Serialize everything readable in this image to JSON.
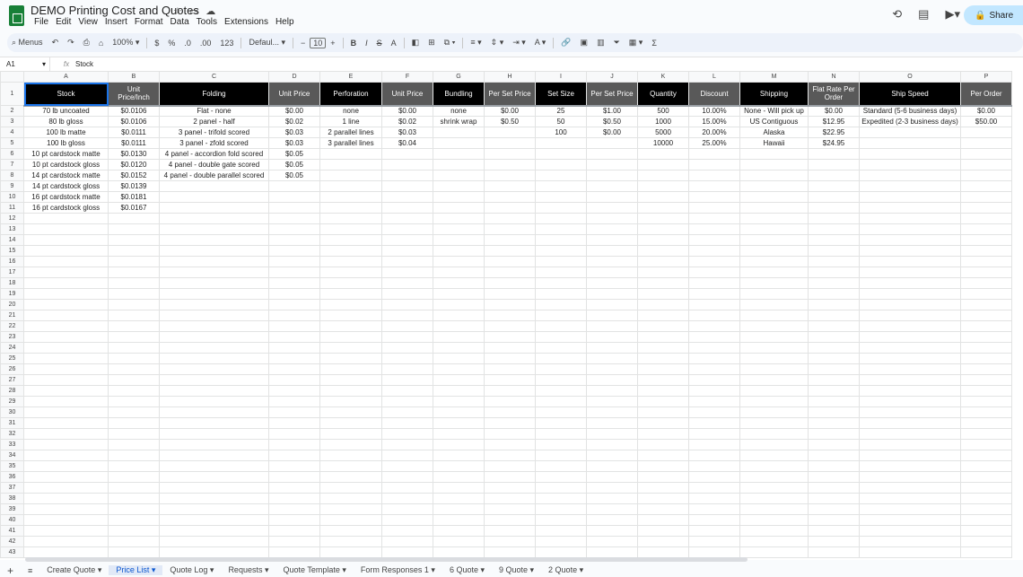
{
  "app": {
    "title": "DEMO Printing Cost and Quotes"
  },
  "menu": [
    "File",
    "Edit",
    "View",
    "Insert",
    "Format",
    "Data",
    "Tools",
    "Extensions",
    "Help"
  ],
  "share_label": "Share",
  "toolbar": {
    "menus": "Menus",
    "zoom": "100%",
    "currency": "$",
    "percent": "%",
    "dec_dec": ".0",
    "inc_dec": ".00",
    "number_fmt": "123",
    "font": "Defaul...",
    "font_size": "10",
    "bold": "B",
    "italic": "I",
    "strike": "S",
    "textcolor": "A"
  },
  "formula": {
    "cell": "A1",
    "value": "Stock"
  },
  "columns": [
    "A",
    "B",
    "C",
    "D",
    "E",
    "F",
    "G",
    "H",
    "I",
    "J",
    "K",
    "L",
    "M",
    "N",
    "O",
    "P"
  ],
  "headers": [
    "Stock",
    "Unit Price/Inch",
    "Folding",
    "Unit Price",
    "Perforation",
    "Unit Price",
    "Bundling",
    "Per Set Price",
    "Set Size",
    "Per Set Price",
    "Quantity",
    "Discount",
    "Shipping",
    "Flat Rate Per Order",
    "Ship Speed",
    "Per Order"
  ],
  "rows": [
    [
      "70 lb uncoated",
      "$0.0106",
      "Flat - none",
      "$0.00",
      "none",
      "$0.00",
      "none",
      "$0.00",
      "25",
      "$1.00",
      "500",
      "10.00%",
      "None - Will pick up",
      "$0.00",
      "Standard (5-6 business days)",
      "$0.00"
    ],
    [
      "80 lb gloss",
      "$0.0106",
      "2 panel - half",
      "$0.02",
      "1 line",
      "$0.02",
      "shrink wrap",
      "$0.50",
      "50",
      "$0.50",
      "1000",
      "15.00%",
      "US Contiguous",
      "$12.95",
      "Expedited (2-3 business days)",
      "$50.00"
    ],
    [
      "100 lb matte",
      "$0.0111",
      "3 panel - trifold scored",
      "$0.03",
      "2 parallel lines",
      "$0.03",
      "",
      "",
      "100",
      "$0.00",
      "5000",
      "20.00%",
      "Alaska",
      "$22.95",
      "",
      ""
    ],
    [
      "100 lb gloss",
      "$0.0111",
      "3 panel - zfold scored",
      "$0.03",
      "3 parallel lines",
      "$0.04",
      "",
      "",
      "",
      "",
      "10000",
      "25.00%",
      "Hawaii",
      "$24.95",
      "",
      ""
    ],
    [
      "10 pt cardstock matte",
      "$0.0130",
      "4 panel - accordion fold scored",
      "$0.05",
      "",
      "",
      "",
      "",
      "",
      "",
      "",
      "",
      "",
      "",
      "",
      ""
    ],
    [
      "10 pt cardstock gloss",
      "$0.0120",
      "4 panel - double gate scored",
      "$0.05",
      "",
      "",
      "",
      "",
      "",
      "",
      "",
      "",
      "",
      "",
      "",
      ""
    ],
    [
      "14 pt cardstock matte",
      "$0.0152",
      "4 panel - double parallel scored",
      "$0.05",
      "",
      "",
      "",
      "",
      "",
      "",
      "",
      "",
      "",
      "",
      "",
      ""
    ],
    [
      "14 pt cardstock gloss",
      "$0.0139",
      "",
      "",
      "",
      "",
      "",
      "",
      "",
      "",
      "",
      "",
      "",
      "",
      "",
      ""
    ],
    [
      "16 pt cardstock matte",
      "$0.0181",
      "",
      "",
      "",
      "",
      "",
      "",
      "",
      "",
      "",
      "",
      "",
      "",
      "",
      ""
    ],
    [
      "16 pt cardstock gloss",
      "$0.0167",
      "",
      "",
      "",
      "",
      "",
      "",
      "",
      "",
      "",
      "",
      "",
      "",
      "",
      ""
    ]
  ],
  "row_numbers": [
    "1",
    "2",
    "3",
    "4",
    "5",
    "6",
    "7",
    "8",
    "9",
    "10",
    "11",
    "12",
    "13",
    "14",
    "15",
    "16",
    "17",
    "18",
    "19",
    "20",
    "21",
    "22",
    "23",
    "24",
    "25",
    "26",
    "27",
    "28",
    "29",
    "30",
    "31",
    "32",
    "33",
    "34",
    "35",
    "36",
    "37",
    "38",
    "39",
    "40",
    "41",
    "42",
    "43"
  ],
  "sheets": [
    {
      "label": "Create Quote",
      "active": false
    },
    {
      "label": "Price List",
      "active": true
    },
    {
      "label": "Quote Log",
      "active": false
    },
    {
      "label": "Requests",
      "active": false
    },
    {
      "label": "Quote Template",
      "active": false
    },
    {
      "label": "Form Responses 1",
      "active": false
    },
    {
      "label": "6 Quote",
      "active": false
    },
    {
      "label": "9 Quote",
      "active": false
    },
    {
      "label": "2 Quote",
      "active": false
    }
  ]
}
